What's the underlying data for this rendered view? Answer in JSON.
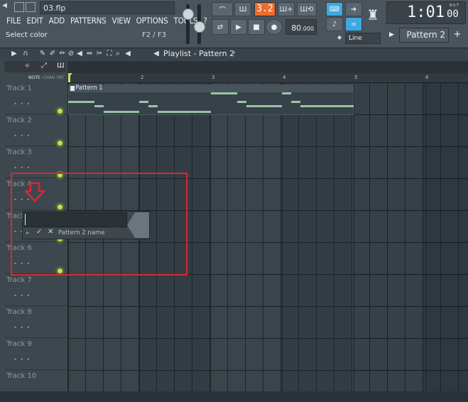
{
  "window": {
    "filename": "03.flp"
  },
  "menu": [
    "FILE",
    "EDIT",
    "ADD",
    "PATTERNS",
    "VIEW",
    "OPTIONS",
    "TOOLS",
    "?"
  ],
  "hint": {
    "text": "Select color",
    "shortcut": "F2 / F3"
  },
  "transport": {
    "pattern_song_display": "3.2",
    "tempo": "80",
    "tempo_decimals": ".000"
  },
  "snap": {
    "mode": "Line"
  },
  "clock": {
    "time": "1:01",
    "fraction": "00",
    "unit": "B:S:T"
  },
  "pattern_selector": {
    "label": "Pattern 2"
  },
  "playlist": {
    "title": "Playlist - Pattern 2"
  },
  "ruler": {
    "labels": [
      "2",
      "3",
      "4",
      "5",
      "6"
    ]
  },
  "left_header": {
    "note": "NOTE",
    "chan": "CHAN",
    "pat": "PAT"
  },
  "tracks": [
    {
      "label": "Track 1"
    },
    {
      "label": "Track 2"
    },
    {
      "label": "Track 3"
    },
    {
      "label": "Track 4"
    },
    {
      "label": "Track 5"
    },
    {
      "label": "Track 6"
    },
    {
      "label": "Track 7"
    },
    {
      "label": "Track 8"
    },
    {
      "label": "Track 9"
    },
    {
      "label": "Track 10"
    }
  ],
  "pattern_clip": {
    "name": "Pattern 1"
  },
  "rename_popup": {
    "value": "",
    "name_label": "Pattern 2 name"
  },
  "colors": {
    "accent_red": "#df2530",
    "led_green": "#bfe25a",
    "note_green": "#98c4a4",
    "tempo_orange": "#f26b2b",
    "active_blue": "#3fa8e0"
  }
}
